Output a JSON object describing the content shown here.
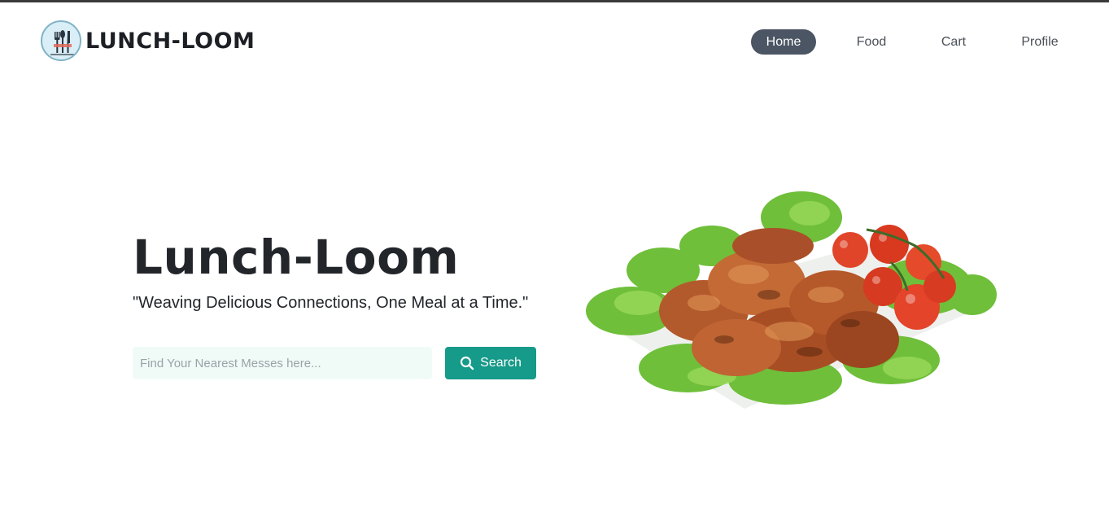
{
  "brand": {
    "name": "LUNCH-LOOM",
    "logo_icon": "cutlery-icon"
  },
  "nav": {
    "items": [
      {
        "label": "Home",
        "active": true
      },
      {
        "label": "Food",
        "active": false
      },
      {
        "label": "Cart",
        "active": false
      },
      {
        "label": "Profile",
        "active": false
      }
    ]
  },
  "hero": {
    "title": "Lunch-Loom",
    "tagline": "\"Weaving Delicious Connections, One Meal at a Time.\"",
    "search": {
      "placeholder": "Find Your Nearest Messes here...",
      "value": ""
    },
    "search_button": {
      "label": "Search",
      "icon": "search-icon"
    },
    "image": "grilled-chicken-plate"
  },
  "colors": {
    "nav_active_bg": "#4b5563",
    "accent": "#169a89",
    "input_bg": "#f0fbf8",
    "text": "#22252a"
  }
}
